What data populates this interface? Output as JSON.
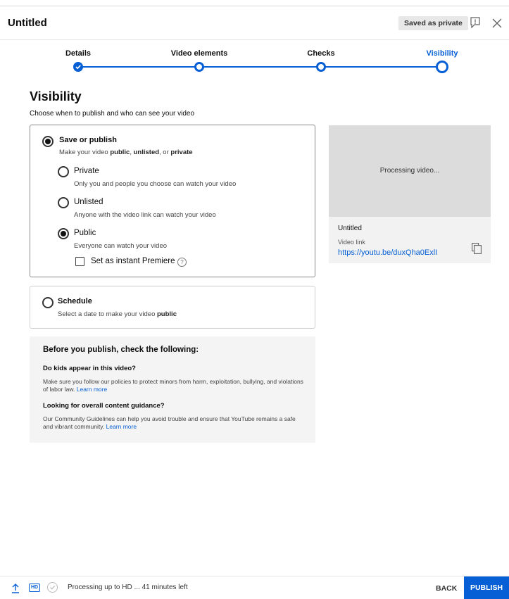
{
  "header": {
    "title": "Untitled",
    "saved_badge": "Saved as private",
    "icons": [
      "feedback-icon",
      "close-icon"
    ]
  },
  "stepper": {
    "steps": [
      {
        "label": "Details",
        "state": "done"
      },
      {
        "label": "Video elements",
        "state": "done"
      },
      {
        "label": "Checks",
        "state": "done"
      },
      {
        "label": "Visibility",
        "state": "active"
      }
    ],
    "accent": "#065fd4"
  },
  "visibility": {
    "title": "Visibility",
    "subtitle": "Choose when to publish and who can see your video"
  },
  "save_card": {
    "label": "Save or publish",
    "desc_pre": "Make your video ",
    "desc_b1": "public",
    "desc_sep1": ", ",
    "desc_b2": "unlisted",
    "desc_sep2": ", or ",
    "desc_b3": "private",
    "options": [
      {
        "label": "Private",
        "desc": "Only you and people you choose can watch your video",
        "checked": false
      },
      {
        "label": "Unlisted",
        "desc": "Anyone with the video link can watch your video",
        "checked": false
      },
      {
        "label": "Public",
        "desc": "Everyone can watch your video",
        "checked": true
      }
    ],
    "premiere_label": "Set as instant Premiere",
    "premiere_checked": false,
    "help_glyph": "?"
  },
  "schedule_card": {
    "label": "Schedule",
    "desc_pre": "Select a date to make your video ",
    "desc_b": "public"
  },
  "preview": {
    "processing": "Processing video...",
    "title": "Untitled",
    "link_label": "Video link",
    "link": "https://youtu.be/duxQha0ExlI"
  },
  "checklist": {
    "title": "Before you publish, check the following:",
    "q1": "Do kids appear in this video?",
    "t1": "Make sure you follow our policies to protect minors from harm, exploitation, bullying, and violations of labor law. ",
    "learn1": "Learn more",
    "q2": "Looking for overall content guidance?",
    "t2": "Our Community Guidelines can help you avoid trouble and ensure that YouTube remains a safe and vibrant community. ",
    "learn2": "Learn more"
  },
  "footer": {
    "hd": "HD",
    "status": "Processing up to HD ... 41 minutes left",
    "back": "BACK",
    "publish": "PUBLISH"
  }
}
